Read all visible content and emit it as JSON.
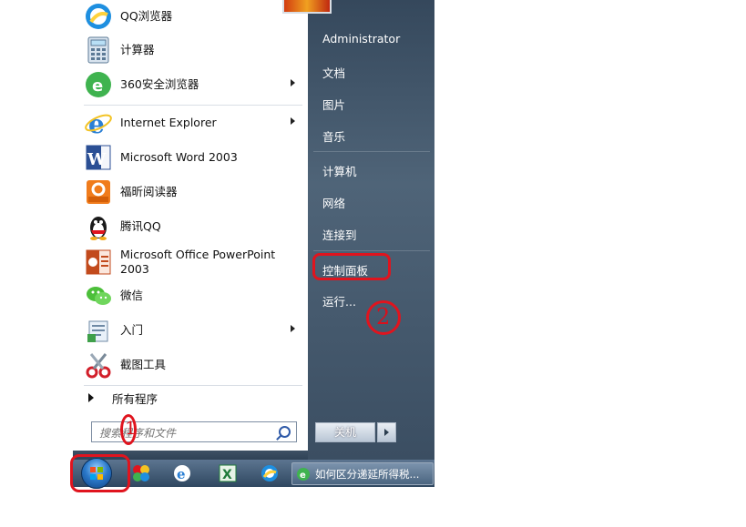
{
  "start_menu": {
    "programs": [
      {
        "label": "QQ浏览器",
        "icon": "qq-browser-icon",
        "submenu": false
      },
      {
        "label": "计算器",
        "icon": "calculator-icon",
        "submenu": false
      },
      {
        "label": "360安全浏览器",
        "icon": "360-browser-icon",
        "submenu": true
      },
      {
        "label": "Internet Explorer",
        "icon": "internet-explorer-icon",
        "submenu": true
      },
      {
        "label": "Microsoft Word 2003",
        "icon": "word-icon",
        "submenu": false
      },
      {
        "label": "福昕阅读器",
        "icon": "foxit-reader-icon",
        "submenu": false
      },
      {
        "label": "腾讯QQ",
        "icon": "qq-penguin-icon",
        "submenu": false
      },
      {
        "label": "Microsoft Office PowerPoint 2003",
        "icon": "powerpoint-icon",
        "submenu": false
      },
      {
        "label": "微信",
        "icon": "wechat-icon",
        "submenu": false
      },
      {
        "label": "入门",
        "icon": "getting-started-icon",
        "submenu": true
      },
      {
        "label": "截图工具",
        "icon": "snipping-tool-icon",
        "submenu": false
      }
    ],
    "all_programs_label": "所有程序",
    "search_placeholder": "搜索程序和文件",
    "right_items": {
      "user": "Administrator",
      "documents": "文档",
      "pictures": "图片",
      "music": "音乐",
      "computer": "计算机",
      "network": "网络",
      "connect": "连接到",
      "control_panel": "控制面板",
      "run": "运行..."
    },
    "shutdown_label": "关机"
  },
  "taskbar": {
    "task_label": "如何区分递延所得税..."
  },
  "annotations": {
    "mark_1": "1",
    "mark_2": "2",
    "color": "#e0141e"
  }
}
